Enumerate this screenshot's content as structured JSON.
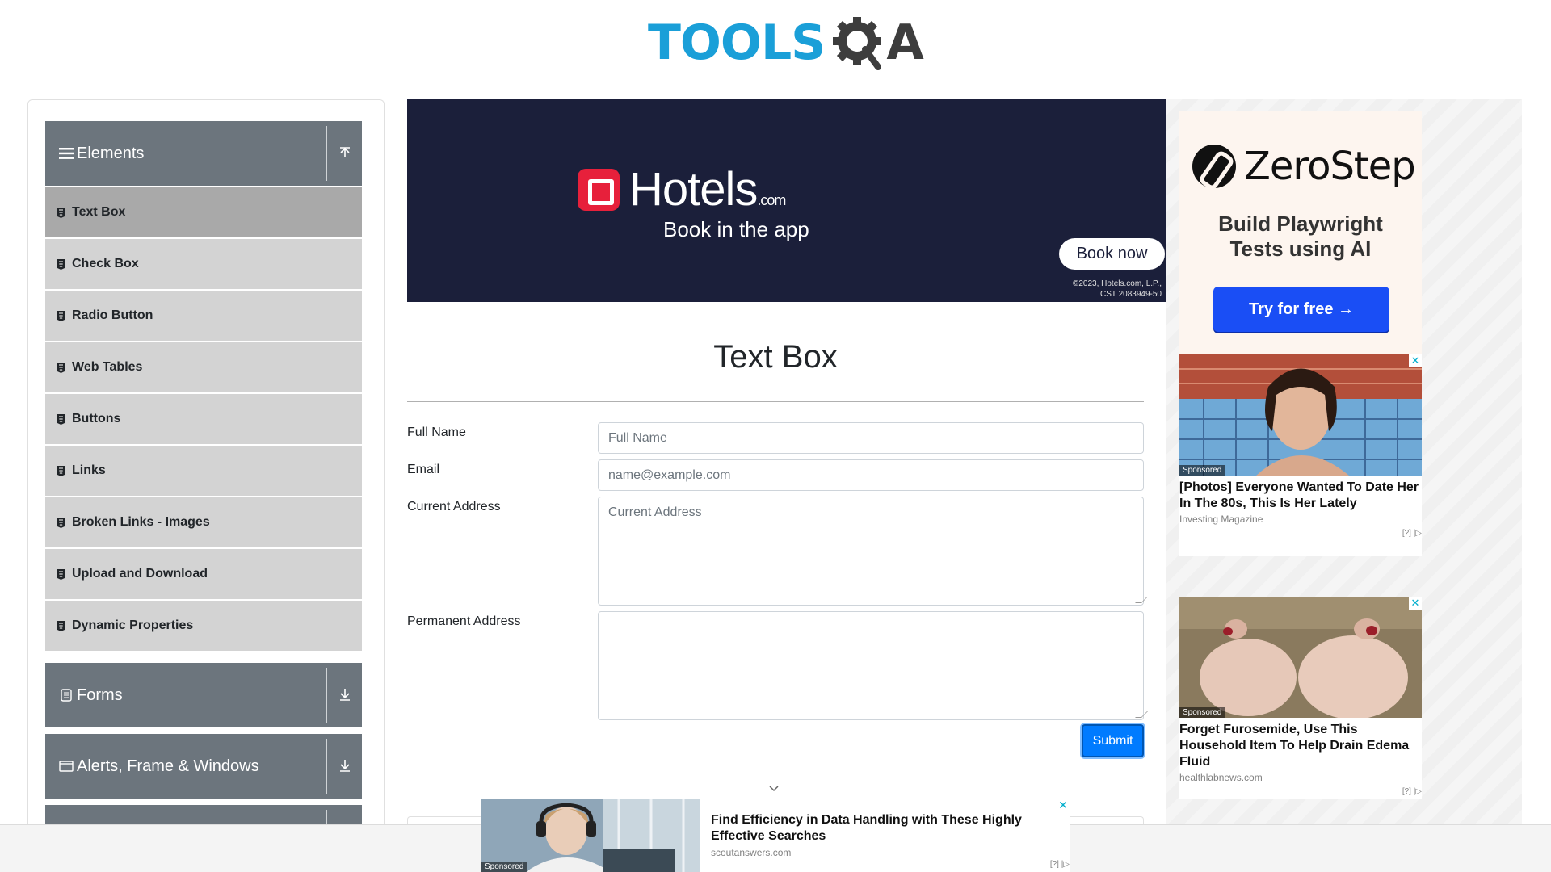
{
  "header": {
    "logo_text_left": "TOOLS",
    "logo_text_right": "A"
  },
  "sidebar": {
    "groups": [
      {
        "label": "Elements",
        "icon": "list-icon",
        "expanded": true
      },
      {
        "label": "Forms",
        "icon": "document-icon",
        "expanded": false
      },
      {
        "label": "Alerts, Frame & Windows",
        "icon": "window-icon",
        "expanded": false
      }
    ],
    "items": [
      {
        "label": "Text Box",
        "active": true
      },
      {
        "label": "Check Box"
      },
      {
        "label": "Radio Button"
      },
      {
        "label": "Web Tables"
      },
      {
        "label": "Buttons"
      },
      {
        "label": "Links"
      },
      {
        "label": "Broken Links - Images"
      },
      {
        "label": "Upload and Download"
      },
      {
        "label": "Dynamic Properties"
      }
    ]
  },
  "banner_ad": {
    "brand": "Hotels",
    "brand_suffix": ".com",
    "tagline": "Book in the app",
    "cta": "Book now",
    "legal_line1": "©2023, Hotels.com, L.P.,",
    "legal_line2": "CST 2083949-50"
  },
  "main": {
    "title": "Text Box",
    "fields": {
      "full_name_label": "Full Name",
      "full_name_placeholder": "Full Name",
      "email_label": "Email",
      "email_placeholder": "name@example.com",
      "current_address_label": "Current Address",
      "current_address_placeholder": "Current Address",
      "permanent_address_label": "Permanent Address",
      "permanent_address_placeholder": ""
    },
    "submit_label": "Submit"
  },
  "right_ads": {
    "zerostep": {
      "brand": "ZeroStep",
      "tagline_line1": "Build Playwright",
      "tagline_line2": "Tests using AI",
      "cta": "Try for free →"
    },
    "cards": [
      {
        "sponsored": "Sponsored",
        "title": "[Photos] Everyone Wanted To Date Her In The 80s, This Is Her Lately",
        "source": "Investing Magazine",
        "choice": "[?] |▷"
      },
      {
        "sponsored": "Sponsored",
        "title": "Forget Furosemide, Use This Household Item To Help Drain Edema Fluid",
        "source": "healthlabnews.com",
        "choice": "[?] |▷"
      }
    ]
  },
  "bottom_ad": {
    "sponsored": "Sponsored",
    "title": "Find Efficiency in Data Handling with These Highly Effective Searches",
    "source": "scoutanswers.com",
    "choice": "[?] |▷",
    "close": "✕"
  },
  "colors": {
    "brand_blue": "#1a9fd8",
    "sidebar_header": "#6c757d",
    "submit_blue": "#007bff",
    "hotels_red": "#e7203b",
    "zerostep_cta": "#1a4ef5"
  }
}
